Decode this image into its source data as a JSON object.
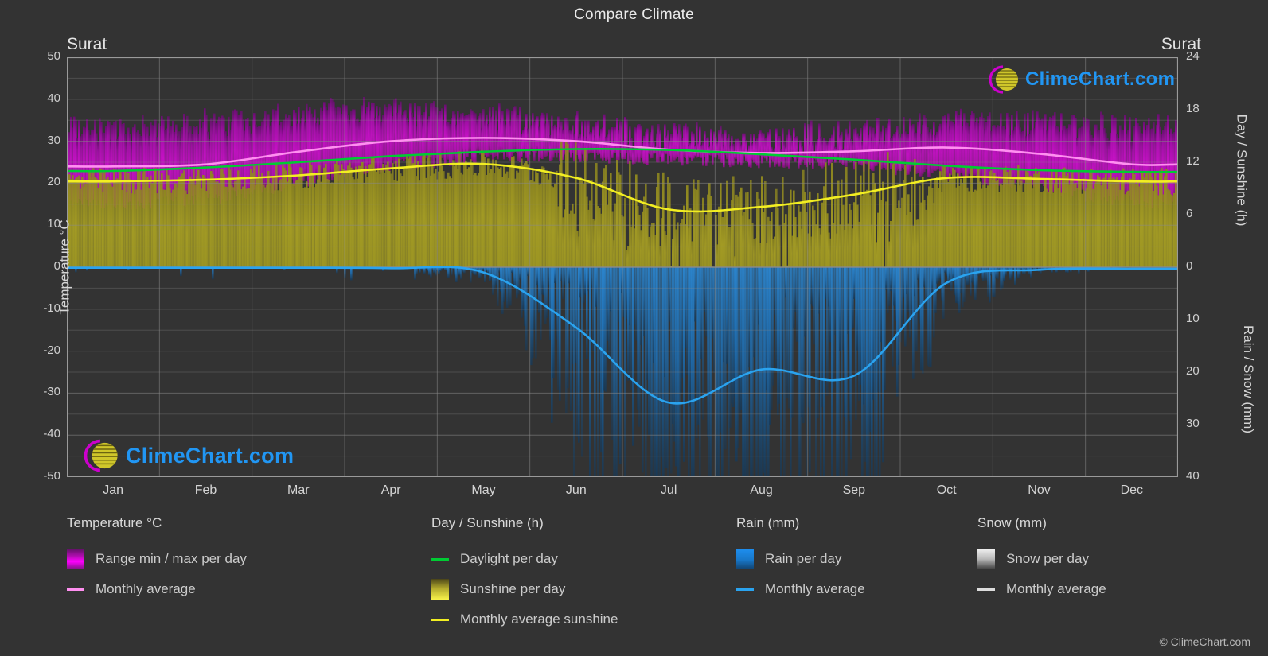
{
  "header": {
    "title": "Compare Climate"
  },
  "locations": {
    "left": "Surat",
    "right": "Surat"
  },
  "copyright": "© ClimeChart.com",
  "watermark": {
    "text": "ClimeChart.com",
    "arc_color": "#cc00cc",
    "globe_color": "#cfc62a",
    "text_color": "#2196f3"
  },
  "axes": {
    "left_title": "Temperature °C",
    "right_title_top": "Day / Sunshine (h)",
    "right_title_bottom": "Rain / Snow (mm)",
    "temp_ticks": [
      "50",
      "40",
      "30",
      "20",
      "10",
      "0",
      "-10",
      "-20",
      "-30",
      "-40",
      "-50"
    ],
    "day_ticks": [
      "24",
      "18",
      "12",
      "6",
      "0"
    ],
    "rain_ticks": [
      "0",
      "10",
      "20",
      "30",
      "40"
    ],
    "month_ticks": [
      "Jan",
      "Feb",
      "Mar",
      "Apr",
      "May",
      "Jun",
      "Jul",
      "Aug",
      "Sep",
      "Oct",
      "Nov",
      "Dec"
    ]
  },
  "legend": {
    "temperature": {
      "head": "Temperature °C",
      "range": "Range min / max per day",
      "average": "Monthly average"
    },
    "day": {
      "head": "Day / Sunshine (h)",
      "daylight": "Daylight per day",
      "sunshine": "Sunshine per day",
      "avg_sunshine": "Monthly average sunshine"
    },
    "rain": {
      "head": "Rain (mm)",
      "per_day": "Rain per day",
      "average": "Monthly average"
    },
    "snow": {
      "head": "Snow (mm)",
      "per_day": "Snow per day",
      "average": "Monthly average"
    }
  },
  "colors": {
    "background": "#333333",
    "grid": "#8a8a8a",
    "temp_range": "#c411c4",
    "temp_avg": "#ff8ff0",
    "daylight": "#00cc33",
    "sunshine_fill": "#a39b24",
    "sunshine_line": "#f2ee22",
    "rain_fill": "#1d6fb5",
    "rain_line": "#2aa3ef",
    "snow": "#dddddd"
  },
  "chart_data": {
    "type": "area",
    "title": "Compare Climate",
    "xlabel": "",
    "ylabel": "Temperature °C",
    "categories": [
      "Jan",
      "Feb",
      "Mar",
      "Apr",
      "May",
      "Jun",
      "Jul",
      "Aug",
      "Sep",
      "Oct",
      "Nov",
      "Dec"
    ],
    "ylim": [
      -50,
      50
    ],
    "ylim_day": [
      0,
      24
    ],
    "ylim_rain": [
      0,
      40
    ],
    "grid": true,
    "legend_position": "bottom",
    "series": [
      {
        "name": "Monthly average temperature",
        "unit": "°C",
        "axis": "temperature",
        "color": "#ff8ff0",
        "values": [
          24.0,
          24.5,
          27.5,
          30.0,
          30.8,
          30.0,
          28.0,
          27.2,
          27.6,
          28.5,
          27.0,
          24.5
        ]
      },
      {
        "name": "Range min / max per day",
        "unit": "°C",
        "axis": "temperature",
        "color": "#c411c4",
        "min": [
          15.0,
          16.0,
          20.0,
          24.0,
          26.5,
          26.5,
          25.5,
          25.0,
          24.5,
          22.0,
          18.5,
          15.5
        ],
        "max": [
          33.0,
          34.0,
          36.5,
          37.5,
          36.0,
          34.0,
          31.5,
          30.5,
          32.0,
          35.0,
          34.5,
          33.0
        ]
      },
      {
        "name": "Daylight per day",
        "unit": "h",
        "axis": "day",
        "color": "#00cc33",
        "values": [
          11.0,
          11.4,
          12.0,
          12.7,
          13.2,
          13.5,
          13.4,
          12.9,
          12.3,
          11.6,
          11.1,
          10.9
        ]
      },
      {
        "name": "Monthly average sunshine",
        "unit": "h",
        "axis": "day",
        "color": "#f2ee22",
        "values": [
          9.8,
          10.0,
          10.5,
          11.3,
          11.8,
          10.2,
          6.6,
          6.9,
          8.3,
          10.2,
          10.1,
          9.8
        ]
      },
      {
        "name": "Monthly average rain",
        "unit": "mm",
        "axis": "rain",
        "color": "#2aa3ef",
        "values": [
          0.1,
          0.1,
          0.1,
          0.2,
          1.0,
          11.5,
          25.8,
          19.5,
          20.7,
          3.0,
          0.5,
          0.3
        ]
      },
      {
        "name": "Monthly average snow",
        "unit": "mm",
        "axis": "rain",
        "color": "#dddddd",
        "values": [
          0,
          0,
          0,
          0,
          0,
          0,
          0,
          0,
          0,
          0,
          0,
          0
        ]
      }
    ]
  }
}
